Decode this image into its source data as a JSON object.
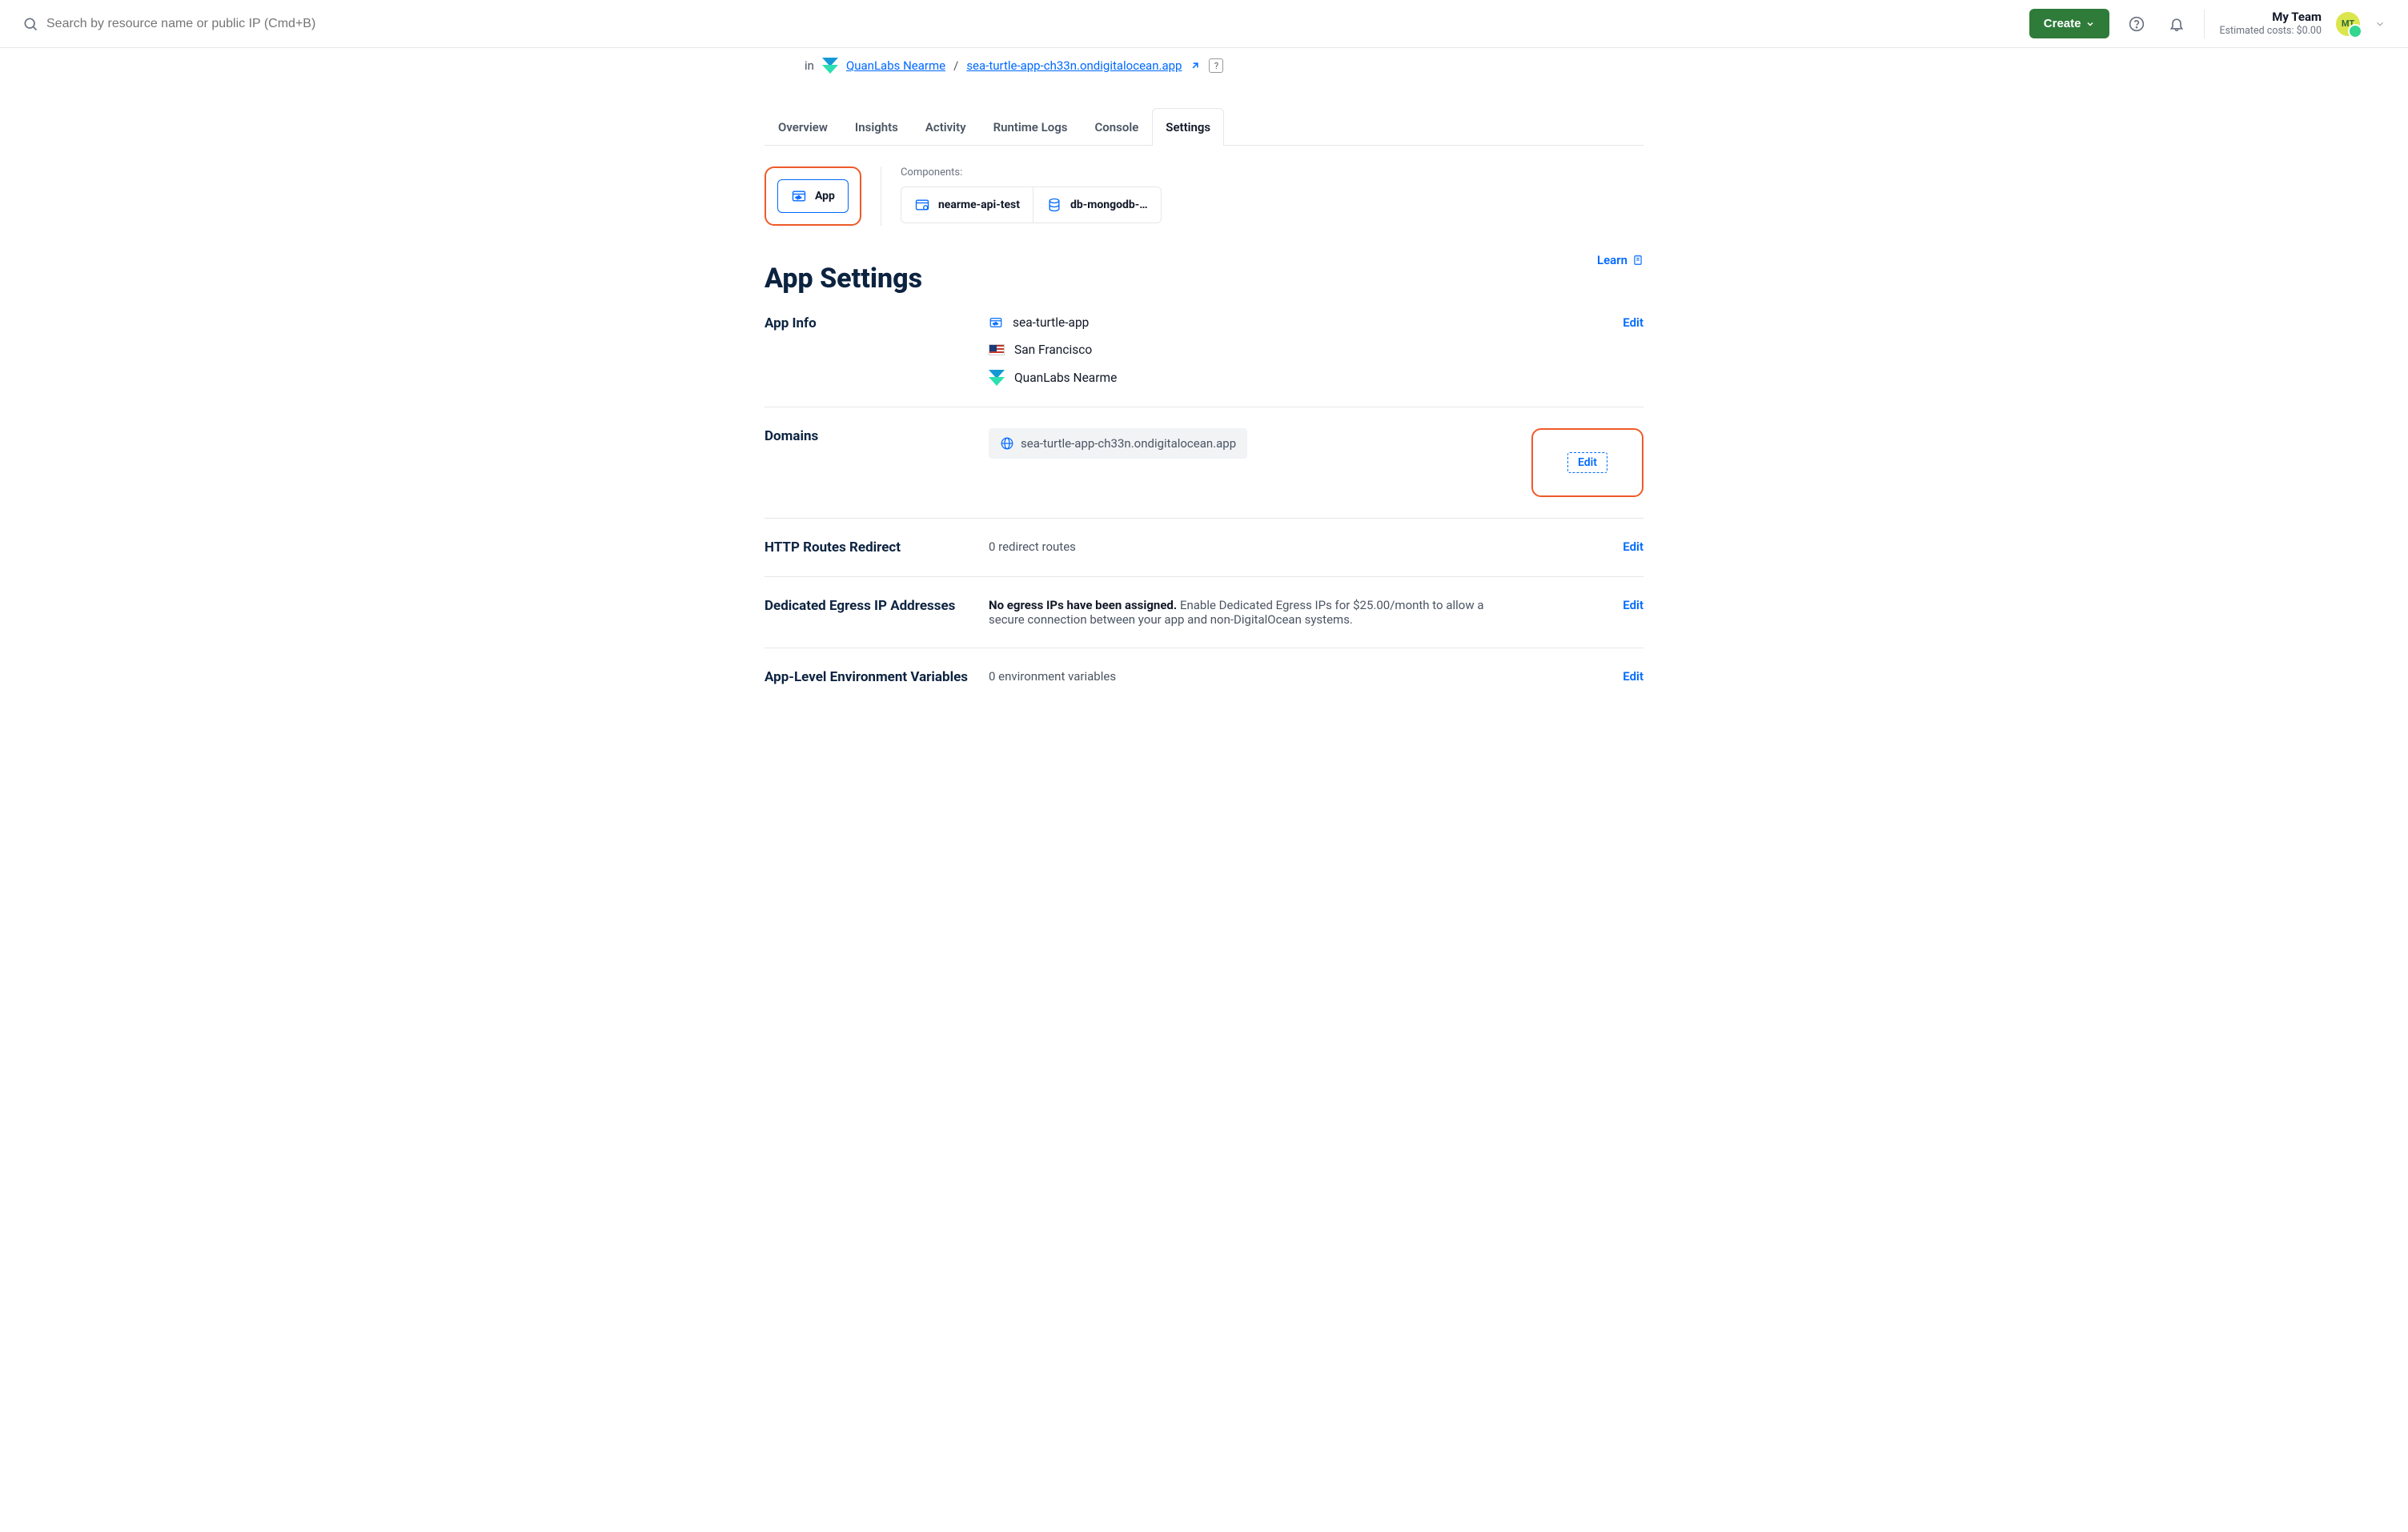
{
  "topbar": {
    "search_placeholder": "Search by resource name or public IP (Cmd+B)",
    "create_label": "Create",
    "team_name": "My Team",
    "team_cost": "Estimated costs: $0.00",
    "avatar_initials": "MT"
  },
  "breadcrumb": {
    "in": "in",
    "project": "QuanLabs Nearme",
    "sep": "/",
    "domain": "sea-turtle-app-ch33n.ondigitalocean.app",
    "help": "?"
  },
  "tabs": {
    "overview": "Overview",
    "insights": "Insights",
    "activity": "Activity",
    "runtime_logs": "Runtime Logs",
    "console": "Console",
    "settings": "Settings"
  },
  "components": {
    "label": "Components:",
    "app": "App",
    "comp1": "nearme-api-test",
    "comp2": "db-mongodb-…"
  },
  "title": "App Settings",
  "learn": "Learn",
  "sections": {
    "app_info": {
      "label": "App Info",
      "name": "sea-turtle-app",
      "region": "San Francisco",
      "project": "QuanLabs Nearme",
      "edit": "Edit"
    },
    "domains": {
      "label": "Domains",
      "domain": "sea-turtle-app-ch33n.ondigitalocean.app",
      "edit": "Edit"
    },
    "http": {
      "label": "HTTP Routes Redirect",
      "value": "0 redirect routes",
      "edit": "Edit"
    },
    "egress": {
      "label": "Dedicated Egress IP Addresses",
      "bold": "No egress IPs have been assigned.",
      "rest": " Enable Dedicated Egress IPs for $25.00/month to allow a secure connection between your app and non-DigitalOcean systems.",
      "edit": "Edit"
    },
    "env": {
      "label": "App-Level Environment Variables",
      "value": "0 environment variables",
      "edit": "Edit"
    }
  }
}
